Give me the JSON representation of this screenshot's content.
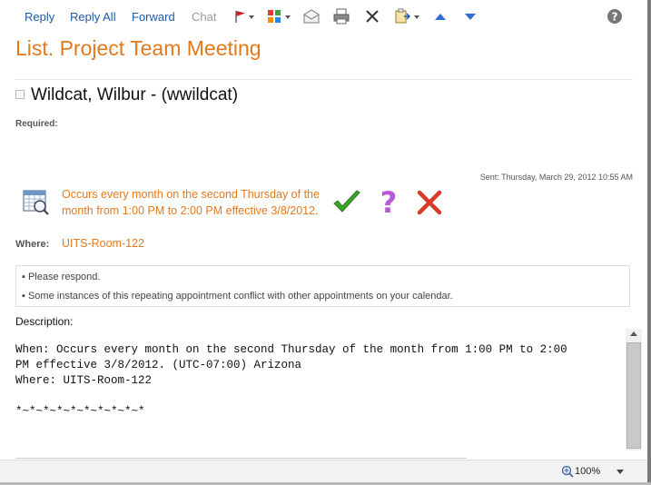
{
  "toolbar": {
    "reply": "Reply",
    "reply_all": "Reply All",
    "forward": "Forward",
    "chat": "Chat",
    "icons": [
      "flag-icon",
      "categorize-icon",
      "mark-read-icon",
      "print-icon",
      "delete-icon",
      "move-icon",
      "previous-item-icon",
      "next-item-icon",
      "help-icon"
    ]
  },
  "message": {
    "title": "List. Project Team Meeting",
    "sender": "Wildcat, Wilbur - (wwildcat)",
    "required_label": "Required:",
    "sent": "Sent: Thursday, March 29, 2012 10:55 AM",
    "occurrence": "Occurs every month on the second Thursday of the month from 1:00 PM to 2:00 PM effective 3/8/2012.",
    "where_label": "Where:",
    "where": "UITS-Room-122",
    "notices": [
      "Please respond.",
      "Some instances of this repeating appointment conflict with other appointments on your calendar."
    ],
    "description_label": "Description:",
    "description": "When: Occurs every month on the second Thursday of the month from 1:00 PM to 2:00\nPM effective 3/8/2012. (UTC-07:00) Arizona\nWhere: UITS-Room-122\n\n*~*~*~*~*~*~*~*~*~*"
  },
  "status": {
    "zoom": "100%"
  },
  "colors": {
    "accent": "#e27a1d",
    "link": "#1e5aa8",
    "accept": "#3aa52a",
    "tentative": "#b85ad6",
    "decline": "#d83a2a"
  }
}
